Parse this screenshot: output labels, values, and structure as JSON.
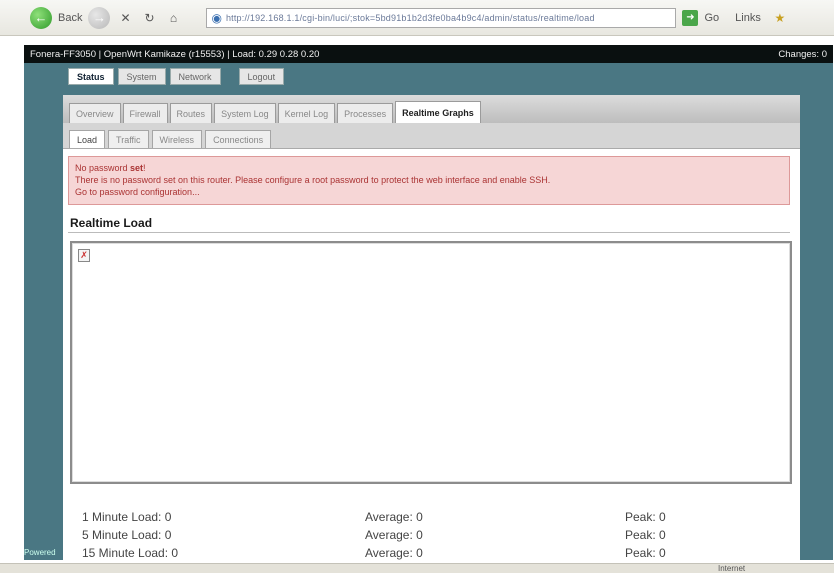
{
  "browser": {
    "back_label": "Back",
    "address_url": "http://192.168.1.1/cgi-bin/luci/;stok=5bd91b1b2d3fe0ba4b9c4/admin/status/realtime/load",
    "go_label": "Go",
    "links_label": "Links",
    "status_right": "Internet"
  },
  "titlebar": {
    "left": "Fonera-FF3050 | OpenWrt Kamikaze (r15553) | Load: 0.29 0.28 0.20",
    "right": "Changes: 0"
  },
  "topnav": [
    {
      "label": "Status",
      "active": true
    },
    {
      "label": "System",
      "active": false
    },
    {
      "label": "Network",
      "active": false
    },
    {
      "label": "Logout",
      "active": false
    }
  ],
  "tabs": [
    {
      "label": "Overview",
      "active": false
    },
    {
      "label": "Firewall",
      "active": false
    },
    {
      "label": "Routes",
      "active": false
    },
    {
      "label": "System Log",
      "active": false
    },
    {
      "label": "Kernel Log",
      "active": false
    },
    {
      "label": "Processes",
      "active": false
    },
    {
      "label": "Realtime Graphs",
      "active": true
    }
  ],
  "subtabs": [
    {
      "label": "Load",
      "active": true
    },
    {
      "label": "Traffic",
      "active": false
    },
    {
      "label": "Wireless",
      "active": false
    },
    {
      "label": "Connections",
      "active": false
    }
  ],
  "alert": {
    "title_prefix": "No password ",
    "title_bold": "set",
    "title_suffix": "!",
    "line2": "There is no password set on this router. Please configure a root password to protect the web interface and enable SSH.",
    "line3": "Go to password configuration..."
  },
  "section": {
    "title": "Realtime Load"
  },
  "stats": [
    {
      "label": "1 Minute Load:",
      "value": "0",
      "avg_label": "Average:",
      "avg_value": "0",
      "peak_label": "Peak:",
      "peak_value": "0"
    },
    {
      "label": "5 Minute Load:",
      "value": "0",
      "avg_label": "Average:",
      "avg_value": "0",
      "peak_label": "Peak:",
      "peak_value": "0"
    },
    {
      "label": "15 Minute Load:",
      "value": "0",
      "avg_label": "Average:",
      "avg_value": "0",
      "peak_label": "Peak:",
      "peak_value": "0"
    }
  ],
  "side_label": "Powered",
  "colors": {
    "frame": "#4a7783",
    "alert_bg": "#f6d6d6",
    "alert_text": "#a33333"
  }
}
